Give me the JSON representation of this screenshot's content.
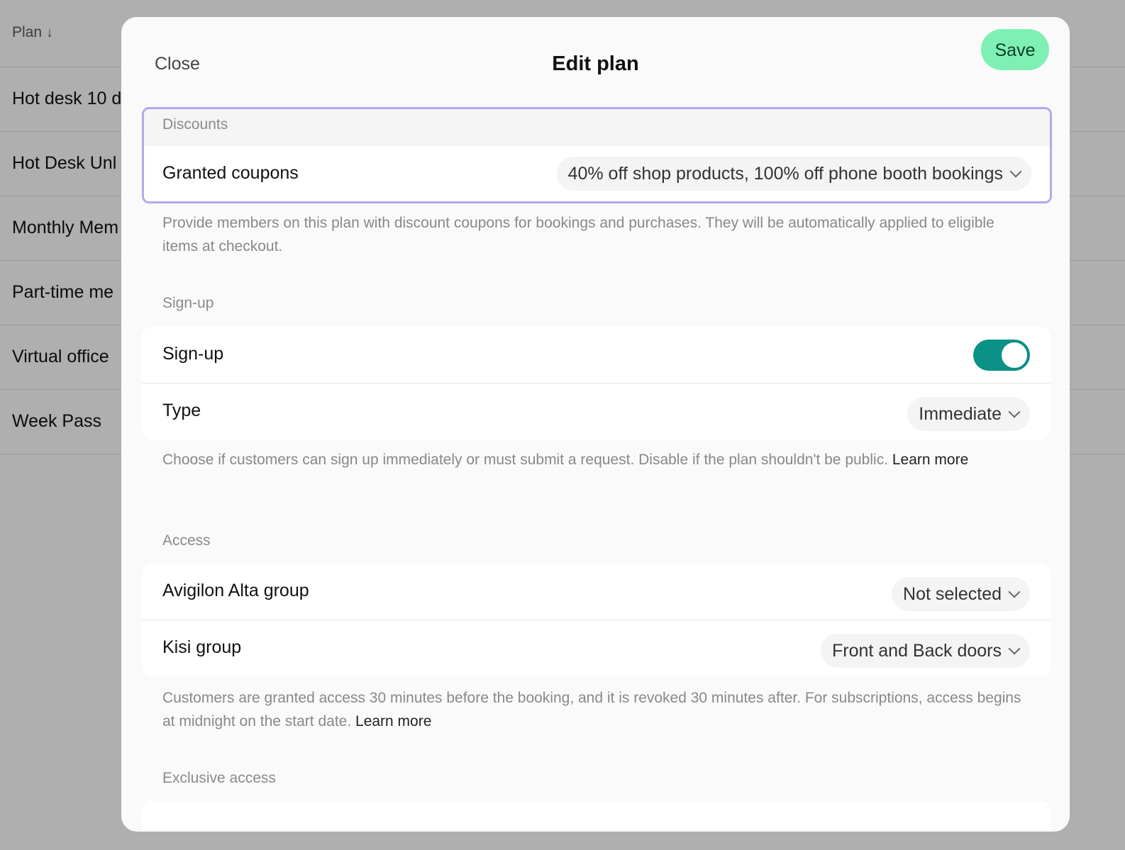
{
  "background_table": {
    "header": {
      "label": "Plan",
      "sort_icon": "arrow-down-icon"
    },
    "rows": [
      "Hot desk 10 d",
      "Hot Desk Unl",
      "Monthly Mem",
      "Part-time me",
      "Virtual office",
      "Week Pass"
    ]
  },
  "modal": {
    "title": "Edit plan",
    "close_label": "Close",
    "save_label": "Save",
    "save_color": "#7ff0b4",
    "discounts": {
      "section_label": "Discounts",
      "granted_coupons_label": "Granted coupons",
      "granted_coupons_value": "40% off shop products, 100% off phone booth bookings",
      "help": "Provide members on this plan with discount coupons for bookings and purchases. They will be automatically applied to eligible items at checkout."
    },
    "signup": {
      "section_label": "Sign-up",
      "toggle_label": "Sign-up",
      "toggle_on": true,
      "toggle_color": "#0b9186",
      "type_label": "Type",
      "type_value": "Immediate",
      "help": "Choose if customers can sign up immediately or must submit a request. Disable if the plan shouldn't be public.",
      "help_link": "Learn more"
    },
    "access": {
      "section_label": "Access",
      "avigilon_label": "Avigilon Alta group",
      "avigilon_value": "Not selected",
      "kisi_label": "Kisi group",
      "kisi_value": "Front and Back doors",
      "help": "Customers are granted access 30 minutes before the booking, and it is revoked 30 minutes after. For subscriptions, access begins at midnight on the start date.",
      "help_link": "Learn more"
    },
    "exclusive_access": {
      "section_label": "Exclusive access"
    }
  }
}
